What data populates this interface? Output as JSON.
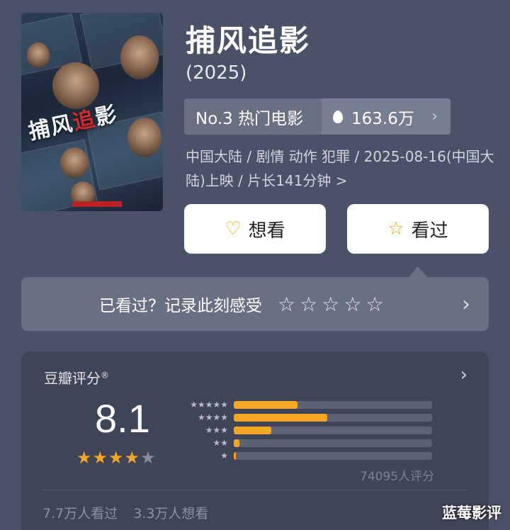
{
  "movie": {
    "title": "捕风追影",
    "year": "(2025)",
    "poster_text": "捕风追影",
    "rank_label": "No.3 热门电影",
    "heat": "163.6万",
    "meta": "中国大陆 / 剧情 动作 犯罪 / 2025-08-16(中国大陆)上映 / 片长141分钟 >"
  },
  "actions": {
    "want_label": "想看",
    "want_icon": "heart-plus-icon",
    "seen_label": "看过",
    "seen_icon": "star-outline-icon"
  },
  "record": {
    "prompt": "已看过？记录此刻感受",
    "stars_count": 5
  },
  "rating": {
    "source_label": "豆瓣评分",
    "registered_mark": "®",
    "score": "8.1",
    "stars_filled": 4,
    "stars_total": 5,
    "distribution": [
      {
        "label": "★★★★★",
        "fraction": 0.32
      },
      {
        "label": "★★★★",
        "fraction": 0.47
      },
      {
        "label": "★★★",
        "fraction": 0.19
      },
      {
        "label": "★★",
        "fraction": 0.03
      },
      {
        "label": "★",
        "fraction": 0.01
      }
    ],
    "votes": "74095人评分",
    "watched": "7.7万人看过",
    "wanted": "3.3万人想看"
  },
  "watermark": "蓝莓影评",
  "colors": {
    "background": "#4b5166",
    "accent": "#f5a623",
    "card": "#3f4457"
  }
}
